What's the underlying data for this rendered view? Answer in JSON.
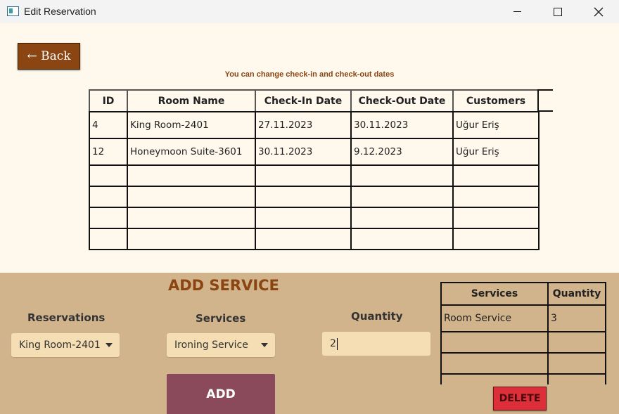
{
  "window": {
    "title": "Edit Reservation"
  },
  "back_button": {
    "label": "← Back"
  },
  "hint": "You can change check-in and check-out dates",
  "reservations_table": {
    "headers": [
      "ID",
      "Room Name",
      "Check-In Date",
      "Check-Out Date",
      "Customers"
    ],
    "rows": [
      [
        "4",
        "King Room-2401",
        "27.11.2023",
        "30.11.2023",
        "Uğur Eriş"
      ],
      [
        "12",
        "Honeymoon Suite-3601",
        "30.11.2023",
        "9.12.2023",
        "Uğur Eriş"
      ],
      [
        "",
        "",
        "",
        "",
        ""
      ],
      [
        "",
        "",
        "",
        "",
        ""
      ],
      [
        "",
        "",
        "",
        "",
        ""
      ],
      [
        "",
        "",
        "",
        "",
        ""
      ]
    ]
  },
  "add_service": {
    "title": "ADD SERVICE",
    "reservations_label": "Reservations",
    "reservations_value": "King Room-2401",
    "services_label": "Services",
    "services_value": "Ironing Service",
    "quantity_label": "Quantity",
    "quantity_value": "2",
    "add_label": "ADD"
  },
  "services_table": {
    "headers": [
      "Services",
      "Quantity"
    ],
    "rows": [
      [
        "Room Service",
        "3"
      ],
      [
        "",
        ""
      ],
      [
        "",
        ""
      ],
      [
        "",
        ""
      ]
    ]
  },
  "delete_button": {
    "label": "DELETE"
  },
  "colors": {
    "background": "#fff9ed",
    "panel": "#d2b48c",
    "accent_brown": "#8b4513",
    "add_button": "#8b4a5c",
    "delete_button": "#dc2f3a",
    "field": "#f5deb3"
  }
}
